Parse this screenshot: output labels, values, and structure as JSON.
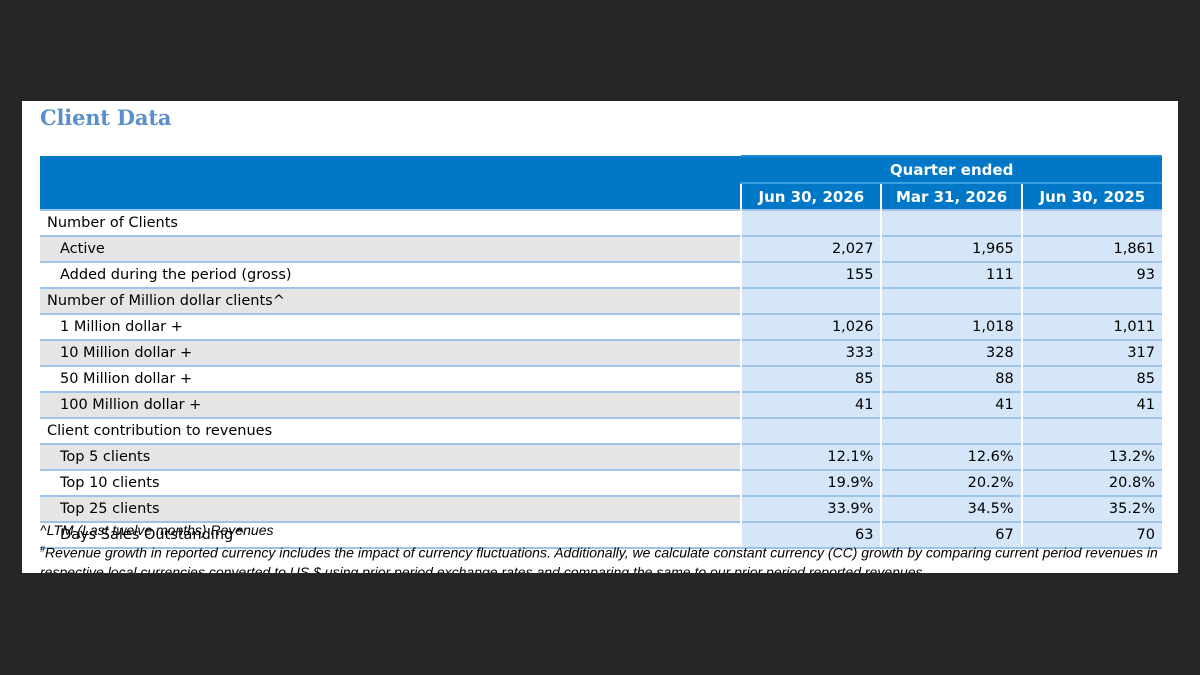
{
  "title": "Client Data",
  "header": {
    "group_label": "Quarter ended",
    "periods": [
      "Jun 30, 2026",
      "Mar 31, 2026",
      "Jun 30, 2025"
    ]
  },
  "rows": [
    {
      "label": "Number of Clients",
      "values": [
        "",
        "",
        ""
      ]
    },
    {
      "label": "Active",
      "values": [
        "2,027",
        "1,965",
        "1,861"
      ]
    },
    {
      "label": "Added during the period (gross)",
      "values": [
        "155",
        "111",
        "93"
      ]
    },
    {
      "label": "Number of Million dollar clients^",
      "values": [
        "",
        "",
        ""
      ]
    },
    {
      "label": "1 Million dollar +",
      "values": [
        "1,026",
        "1,018",
        "1,011"
      ]
    },
    {
      "label": "10 Million dollar +",
      "values": [
        "333",
        "328",
        "317"
      ]
    },
    {
      "label": "50 Million dollar +",
      "values": [
        "85",
        "88",
        "85"
      ]
    },
    {
      "label": "100 Million dollar +",
      "values": [
        "41",
        "41",
        "41"
      ]
    },
    {
      "label": "Client contribution to revenues",
      "values": [
        "",
        "",
        ""
      ]
    },
    {
      "label": "Top 5 clients",
      "values": [
        "12.1%",
        "12.6%",
        "13.2%"
      ]
    },
    {
      "label": "Top 10 clients",
      "values": [
        "19.9%",
        "20.2%",
        "20.8%"
      ]
    },
    {
      "label": "Top 25 clients",
      "values": [
        "33.9%",
        "34.5%",
        "35.2%"
      ]
    },
    {
      "label": "Days Sales Outstanding^",
      "values": [
        "63",
        "67",
        "70"
      ]
    }
  ],
  "notes": {
    "ltm": "^LTM (Last twelve months) Revenues",
    "cc_marker": "#",
    "cc": "Revenue growth in reported currency includes the impact of currency fluctuations. Additionally, we calculate constant currency (CC) growth by comparing current period revenues in respective local currencies converted to US $ using prior period exchange rates and comparing the same to our prior period reported revenues."
  }
}
